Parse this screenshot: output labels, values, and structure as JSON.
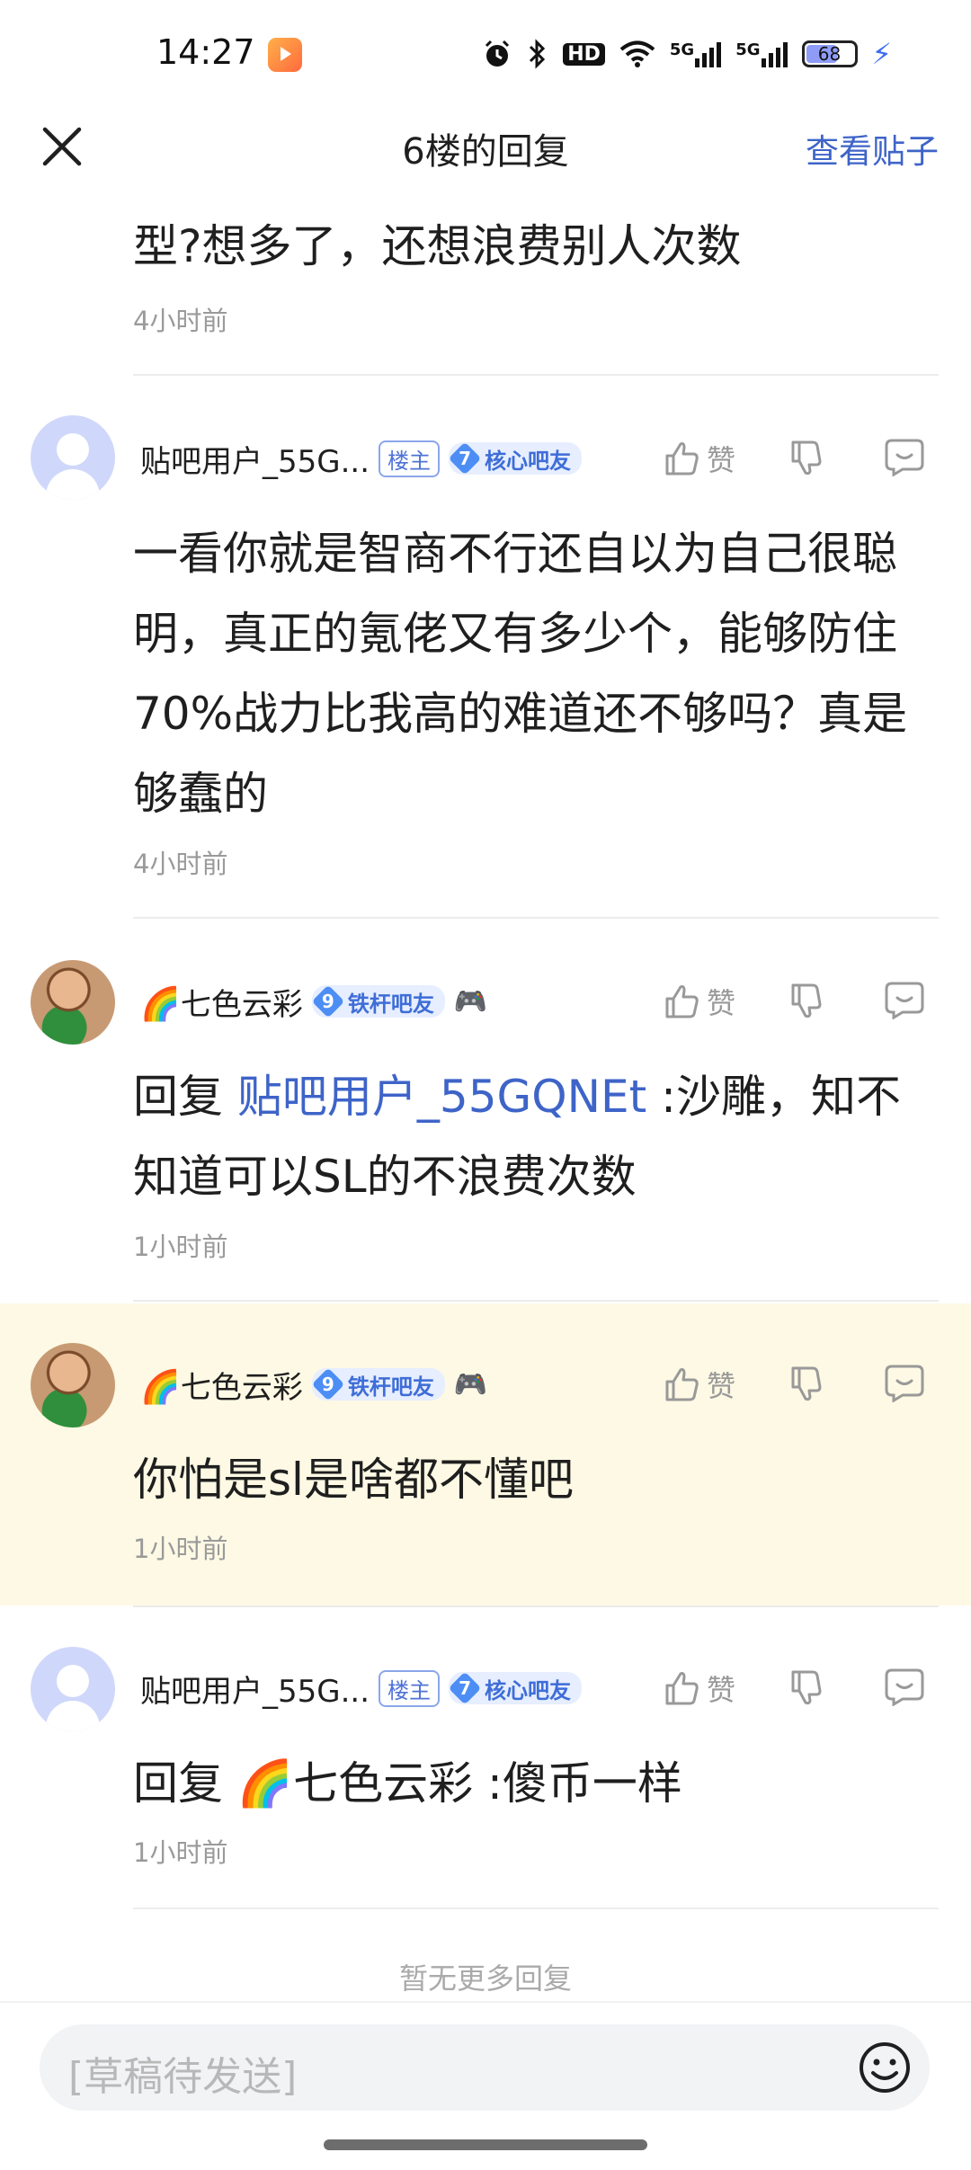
{
  "status_bar": {
    "time": "14:27",
    "icons": [
      "alarm-icon",
      "bluetooth-icon",
      "hd-icon",
      "wifi-icon",
      "signal-5g-icon",
      "signal-5g-icon",
      "battery-icon",
      "charging-icon"
    ],
    "hd_label": "HD",
    "net1": "5G",
    "net2": "5G",
    "battery_level": "68",
    "battery_fraction": 0.68
  },
  "nav": {
    "title": "6楼的回复",
    "view_post": "查看贴子"
  },
  "partial_reply": {
    "content": "型?想多了，还想浪费别人次数",
    "time": "4小时前"
  },
  "replies": [
    {
      "username": "贴吧用户_55G...",
      "is_op": true,
      "op_badge": "楼主",
      "level": "7",
      "level_title": "核心吧友",
      "like_label": "赞",
      "content": "一看你就是智商不行还自以为自己很聪明，真正的氪佬又有多少个，能够防住70%战力比我高的难道还不够吗？真是够蠢的",
      "time": "4小时前"
    },
    {
      "username": "七色云彩",
      "rainbow": "🌈",
      "level": "9",
      "level_title": "铁杆吧友",
      "like_label": "赞",
      "reply_prefix": "回复 ",
      "mention": "贴吧用户_55GQNEt",
      "content_after": " :沙雕，知不知道可以SL的不浪费次数",
      "time": "1小时前"
    },
    {
      "username": "七色云彩",
      "rainbow": "🌈",
      "level": "9",
      "level_title": "铁杆吧友",
      "like_label": "赞",
      "content": "你怕是sl是啥都不懂吧",
      "time": "1小时前",
      "highlighted": true
    },
    {
      "username": "贴吧用户_55G...",
      "is_op": true,
      "op_badge": "楼主",
      "level": "7",
      "level_title": "核心吧友",
      "like_label": "赞",
      "content": "回复 🌈七色云彩 :傻币一样",
      "time": "1小时前"
    }
  ],
  "footer": {
    "no_more": "暂无更多回复",
    "draft_placeholder": "[草稿待发送]"
  }
}
